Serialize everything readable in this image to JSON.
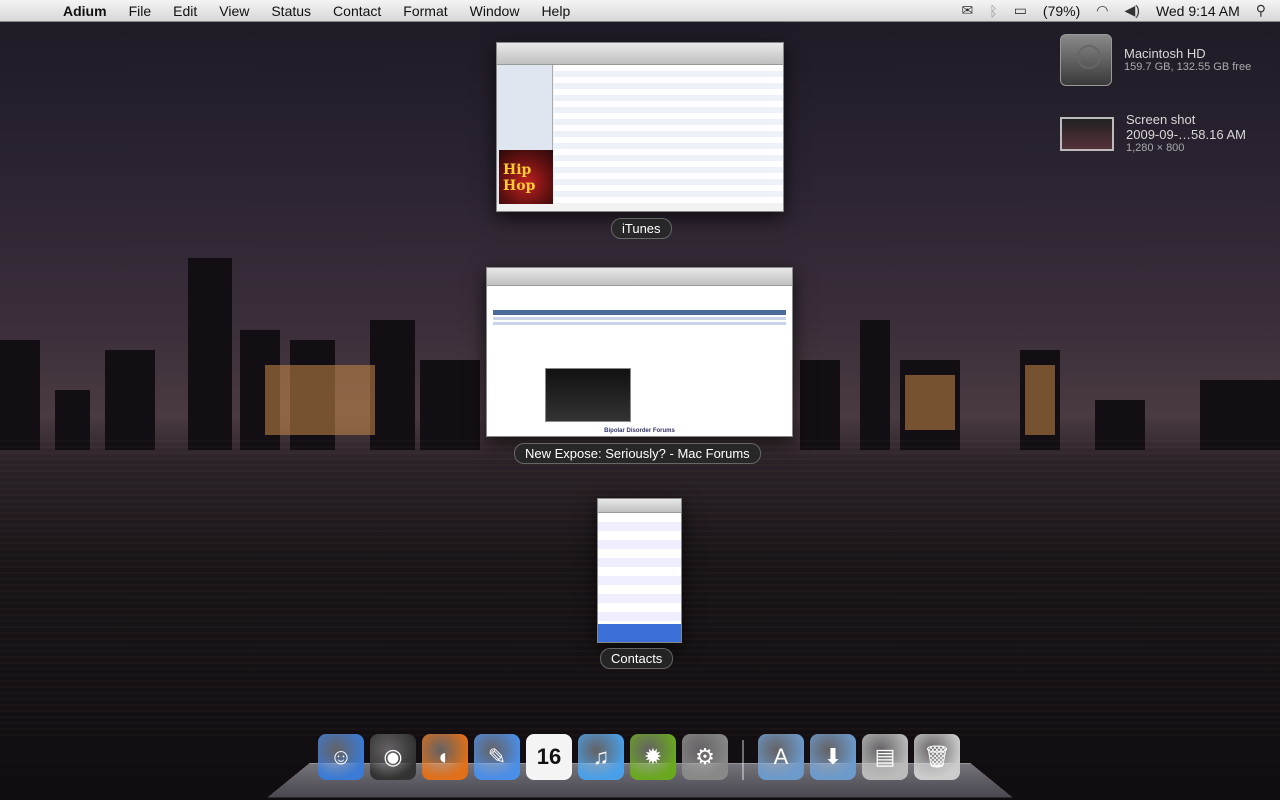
{
  "menubar": {
    "apple": "",
    "app_name": "Adium",
    "items": [
      "File",
      "Edit",
      "View",
      "Status",
      "Contact",
      "Format",
      "Window",
      "Help"
    ],
    "battery": "(79%)",
    "clock": "Wed 9:14 AM"
  },
  "desktop": {
    "drive": {
      "name": "Macintosh HD",
      "info": "159.7 GB, 132.55 GB free"
    },
    "screenshot": {
      "name_line1": "Screen shot",
      "name_line2": "2009-09-…58.16 AM",
      "info": "1,280 × 800"
    }
  },
  "windows": {
    "itunes": {
      "label": "iTunes",
      "art_text": "Hip Hop"
    },
    "firefox": {
      "label": "New Expose: Seriously? - Mac Forums",
      "footer": "Bipolar Disorder Forums"
    },
    "contacts": {
      "label": "Contacts"
    }
  },
  "dock": {
    "apps": [
      {
        "name": "finder-icon",
        "glyph": "☺",
        "color": "#3b7bd6"
      },
      {
        "name": "dashboard-icon",
        "glyph": "◉",
        "color": "#333"
      },
      {
        "name": "firefox-icon",
        "glyph": "◐",
        "color": "#e0701a"
      },
      {
        "name": "adium-icon",
        "glyph": "✎",
        "color": "#4a8ee8"
      },
      {
        "name": "ical-icon",
        "glyph": "16",
        "color": "#eee"
      },
      {
        "name": "itunes-icon",
        "glyph": "♫",
        "color": "#4aa0e8"
      },
      {
        "name": "limewire-icon",
        "glyph": "✹",
        "color": "#6aa820"
      },
      {
        "name": "system-preferences-icon",
        "glyph": "⚙",
        "color": "#888"
      }
    ],
    "stacks": [
      {
        "name": "applications-folder-icon",
        "glyph": "A",
        "color": "#6c9acb"
      },
      {
        "name": "downloads-folder-icon",
        "glyph": "⬇",
        "color": "#6c9acb"
      },
      {
        "name": "documents-stack-icon",
        "glyph": "▤",
        "color": "#bbb"
      },
      {
        "name": "trash-icon",
        "glyph": "🗑",
        "color": "#ccc"
      }
    ]
  }
}
